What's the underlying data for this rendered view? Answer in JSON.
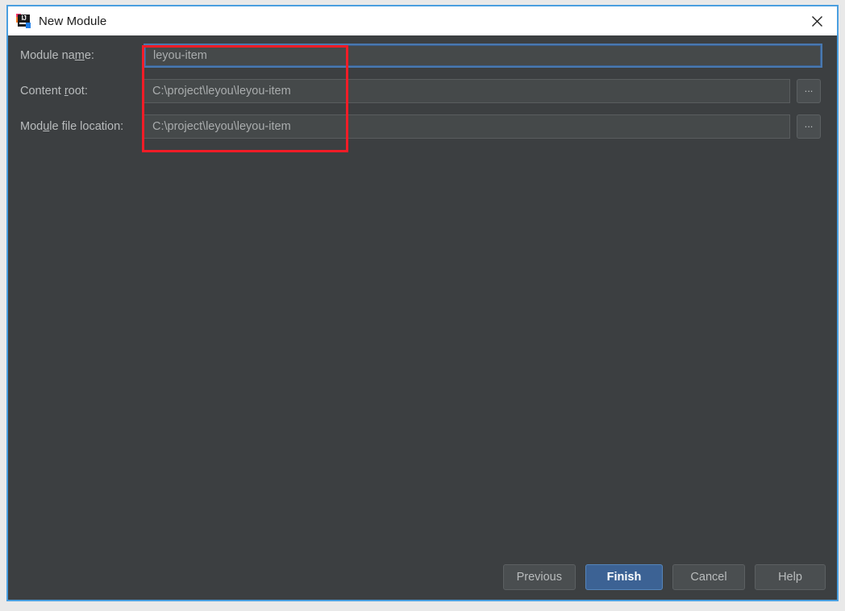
{
  "window": {
    "title": "New Module",
    "app_icon": "intellij-idea-icon",
    "close_icon": "close-icon",
    "border_color": "#4a9fe0",
    "body_background": "#3c3f41"
  },
  "form": {
    "rows": [
      {
        "id": "module-name",
        "label_before": "Module na",
        "label_mnemonic": "m",
        "label_after": "e:",
        "value": "leyou-item",
        "focused": true,
        "has_browse": false
      },
      {
        "id": "content-root",
        "label_before": "Content ",
        "label_mnemonic": "r",
        "label_after": "oot:",
        "value": "C:\\project\\leyou\\leyou-item",
        "focused": false,
        "has_browse": true,
        "browse_label": "..."
      },
      {
        "id": "module-file",
        "label_before": "Mod",
        "label_mnemonic": "u",
        "label_after": "le file location:",
        "value": "C:\\project\\leyou\\leyou-item",
        "focused": false,
        "has_browse": true,
        "browse_label": "..."
      }
    ]
  },
  "annotation": {
    "name": "red-highlight-rectangle",
    "color": "#f41c27"
  },
  "footer": {
    "previous_label": "Previous",
    "finish_label": "Finish",
    "cancel_label": "Cancel",
    "help_label": "Help",
    "primary_color": "#3c6294"
  }
}
